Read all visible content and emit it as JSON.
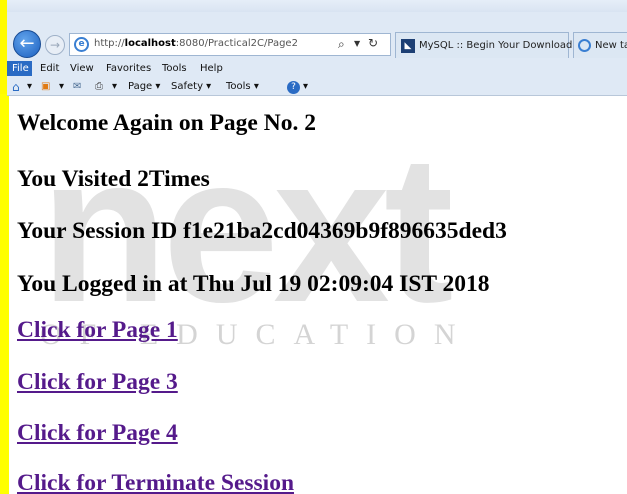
{
  "browser": {
    "address_url_prefix": "http://",
    "address_url_host": "localhost",
    "address_url_rest": ":8080/Practical2C/Page2",
    "tabs": [
      {
        "label": "MySQL :: Begin Your Download"
      },
      {
        "label": "New tab"
      }
    ],
    "menu": [
      "File",
      "Edit",
      "View",
      "Favorites",
      "Tools",
      "Help"
    ],
    "command_bar": {
      "page_label": "Page ▾",
      "safety_label": "Safety ▾",
      "tools_label": "Tools ▾",
      "home_dropdown": "▾",
      "feeds_dropdown": "▾",
      "mail_dropdown": "▾",
      "print_dropdown": "▾",
      "help_dropdown": "▾"
    }
  },
  "watermark": {
    "word": "next",
    "subtitle": "OF EDUCATION"
  },
  "page": {
    "heading": "Welcome Again on Page No. 2",
    "visited": "You Visited 2Times",
    "session_id": "Your Session ID f1e21ba2cd04369b9f896635ded3",
    "login_time": "You Logged in at Thu Jul 19 02:09:04 IST 2018",
    "links": [
      "Click for Page 1",
      "Click for Page 3",
      "Click for Page 4",
      "Click for Terminate Session"
    ]
  }
}
